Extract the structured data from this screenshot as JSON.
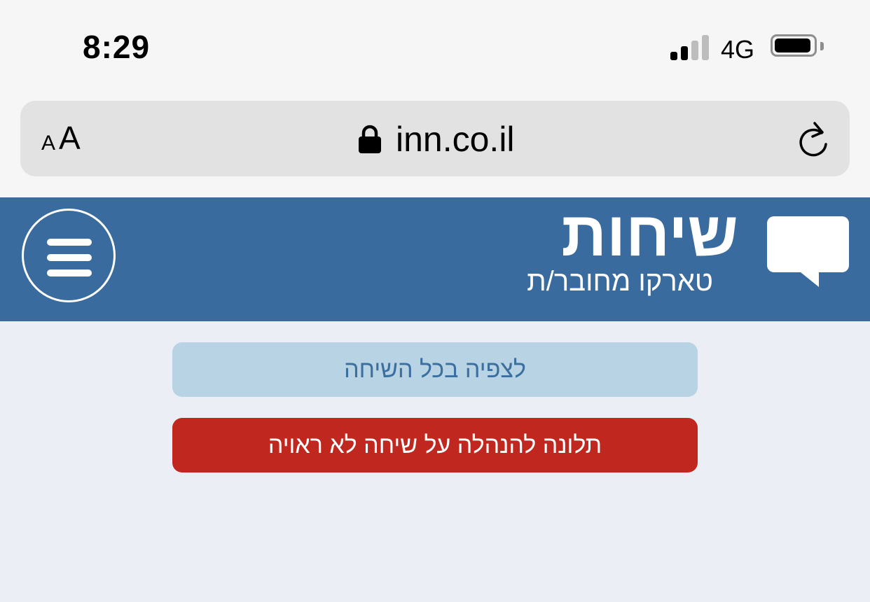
{
  "status_bar": {
    "time": "8:29",
    "network": "4G",
    "signal_bars_active": 2,
    "signal_bars_total": 4,
    "battery_level": 0.95
  },
  "address_bar": {
    "text_size_small": "A",
    "text_size_large": "A",
    "url": "inn.co.il",
    "lock_icon": "lock-icon",
    "reload_icon": "reload-icon"
  },
  "header": {
    "title": "שיחות",
    "subtitle": "טארקו מחובר/ת",
    "menu_icon": "hamburger-menu-icon",
    "logo_icon": "chat-bubble-icon",
    "background_color": "#396b9e"
  },
  "actions": {
    "view_conversation": "לצפיה בכל השיחה",
    "report_conversation": "תלונה להנהלה על שיחה לא ראויה"
  },
  "colors": {
    "view_button_bg": "#b8d3e3",
    "view_button_text": "#3c6e9e",
    "report_button_bg": "#c0271e",
    "content_bg": "#ebeff5"
  }
}
